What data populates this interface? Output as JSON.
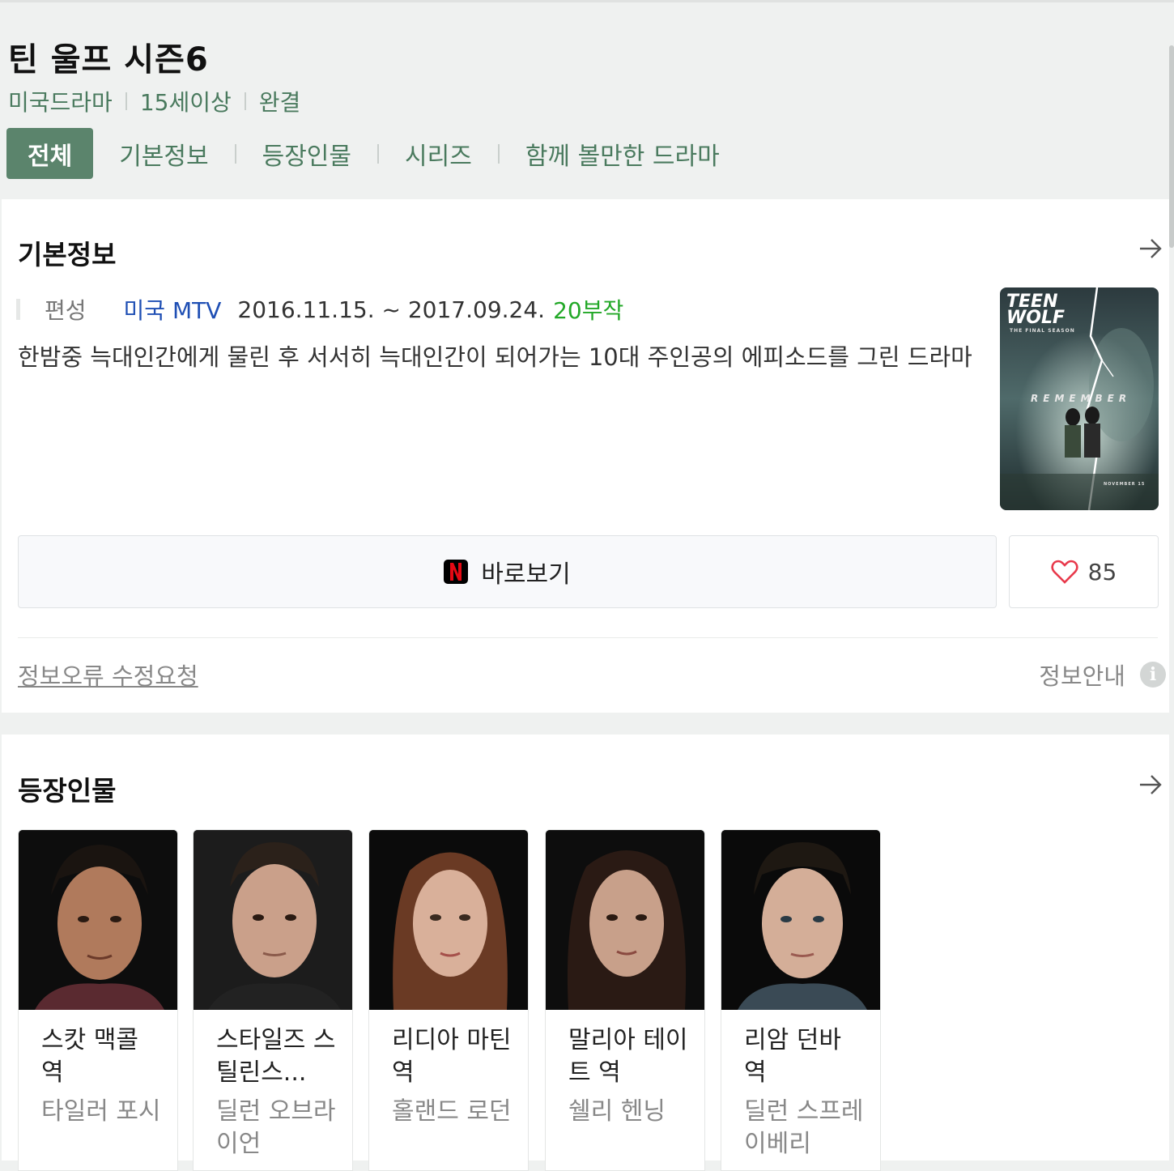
{
  "header": {
    "title": "틴 울프 시즌6",
    "meta": [
      "미국드라마",
      "15세이상",
      "완결"
    ],
    "tabs": [
      "전체",
      "기본정보",
      "등장인물",
      "시리즈",
      "함께 볼만한 드라마"
    ]
  },
  "basic_info": {
    "section_title": "기본정보",
    "broadcast_label": "편성",
    "network": "미국 MTV",
    "date_range": "2016.11.15. ~ 2017.09.24.",
    "episodes": "20부작",
    "description": "한밤중 늑대인간에게 물린 후 서서히 늑대인간이 되어가는 10대 주인공의 에피소드를 그린 드라마",
    "poster": {
      "logo_line1": "TEEN",
      "logo_line2": "WOLF",
      "tagline": "THE FINAL SEASON",
      "word": "REMEMBER",
      "date_text": "NOVEMBER 15"
    },
    "watch_button": "바로보기",
    "like_count": "85",
    "fix_request": "정보오류 수정요청",
    "info_guide": "정보안내"
  },
  "cast_section": {
    "section_title": "등장인물",
    "members": [
      {
        "role": "스캇 맥콜 역",
        "actor": "타일러 포시"
      },
      {
        "role": "스타일즈 스틸린스...",
        "actor": "딜런 오브라이언"
      },
      {
        "role": "리디아 마틴 역",
        "actor": "홀랜드 로던"
      },
      {
        "role": "말리아 테이트 역",
        "actor": "쉘리 헨닝"
      },
      {
        "role": "리암 던바 역",
        "actor": "딜런 스프레이베리"
      }
    ]
  },
  "colors": {
    "accent_green": "#5b846c",
    "meta_green": "#4a7a5e",
    "episode_green": "#22a827",
    "network_blue": "#1f4fb4",
    "heart_red": "#e8394b"
  }
}
